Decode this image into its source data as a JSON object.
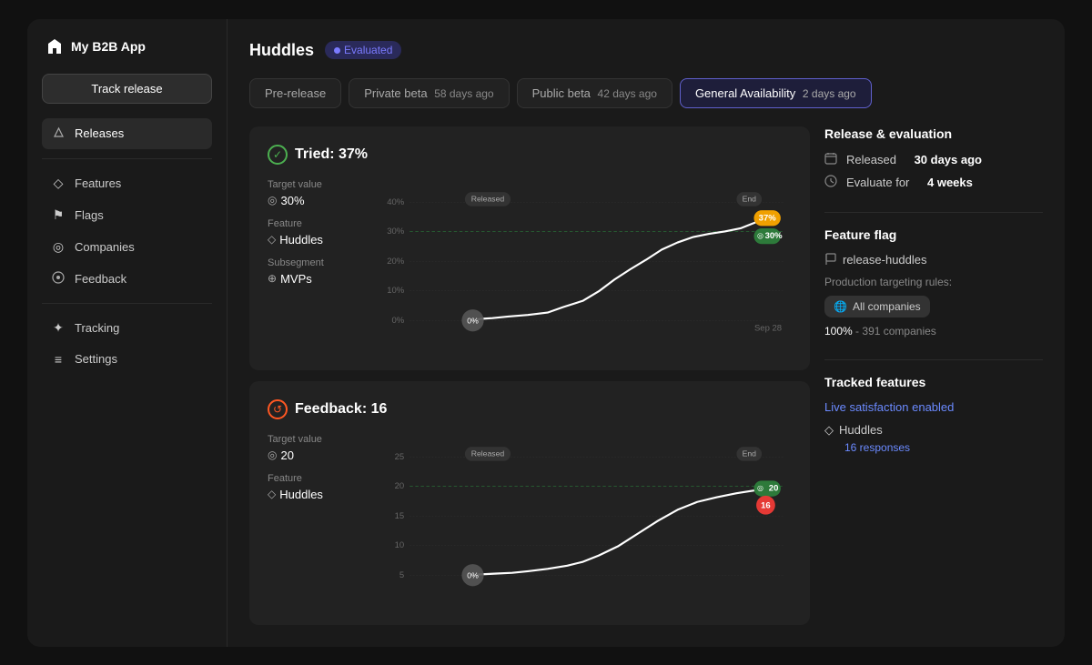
{
  "app": {
    "name": "My B2B App"
  },
  "sidebar": {
    "track_release_label": "Track release",
    "items": [
      {
        "id": "releases",
        "label": "Releases",
        "icon": "🚀",
        "active": true
      },
      {
        "id": "features",
        "label": "Features",
        "icon": "◇"
      },
      {
        "id": "flags",
        "label": "Flags",
        "icon": "⚑"
      },
      {
        "id": "companies",
        "label": "Companies",
        "icon": "◎"
      },
      {
        "id": "feedback",
        "label": "Feedback",
        "icon": "💬"
      },
      {
        "id": "tracking",
        "label": "Tracking",
        "icon": "✦"
      },
      {
        "id": "settings",
        "label": "Settings",
        "icon": "≡"
      }
    ]
  },
  "page": {
    "title": "Huddles",
    "badge": "Evaluated"
  },
  "stages": [
    {
      "id": "pre-release",
      "label": "Pre-release",
      "time": "",
      "active": false
    },
    {
      "id": "private-beta",
      "label": "Private beta",
      "time": "58 days ago",
      "active": false
    },
    {
      "id": "public-beta",
      "label": "Public beta",
      "time": "42 days ago",
      "active": false
    },
    {
      "id": "ga",
      "label": "General Availability",
      "time": "2 days ago",
      "active": true
    }
  ],
  "chart1": {
    "title": "Tried: 37%",
    "target_label": "Target value",
    "target_value": "30%",
    "feature_label": "Feature",
    "feature_value": "Huddles",
    "subsegment_label": "Subsegment",
    "subsegment_value": "MVPs",
    "released_label": "Released",
    "end_label": "End",
    "start_pct": "0%",
    "current_pct": "37%",
    "target_pct_label": "30%",
    "date_label": "Sep 28",
    "y_labels": [
      "40%",
      "30%",
      "20%",
      "10%",
      "0%"
    ]
  },
  "chart2": {
    "title": "Feedback: 16",
    "target_label": "Target value",
    "target_value": "20",
    "feature_label": "Feature",
    "feature_value": "Huddles",
    "released_label": "Released",
    "end_label": "End",
    "start_pct": "0%",
    "current_val": "16",
    "target_val_label": "20",
    "y_labels": [
      "25",
      "20",
      "15",
      "10",
      "5"
    ]
  },
  "right_panel": {
    "release_section_title": "Release & evaluation",
    "released_label": "Released",
    "released_value": "30 days ago",
    "evaluate_label": "Evaluate for",
    "evaluate_value": "4 weeks",
    "flag_section_title": "Feature flag",
    "flag_name": "release-huddles",
    "production_label": "Production targeting rules:",
    "company_badge": "All companies",
    "company_pct": "100%",
    "company_count": "391 companies",
    "tracked_section_title": "Tracked features",
    "tracked_link": "Live satisfaction enabled",
    "tracked_feature": "Huddles",
    "tracked_responses": "16 responses"
  }
}
